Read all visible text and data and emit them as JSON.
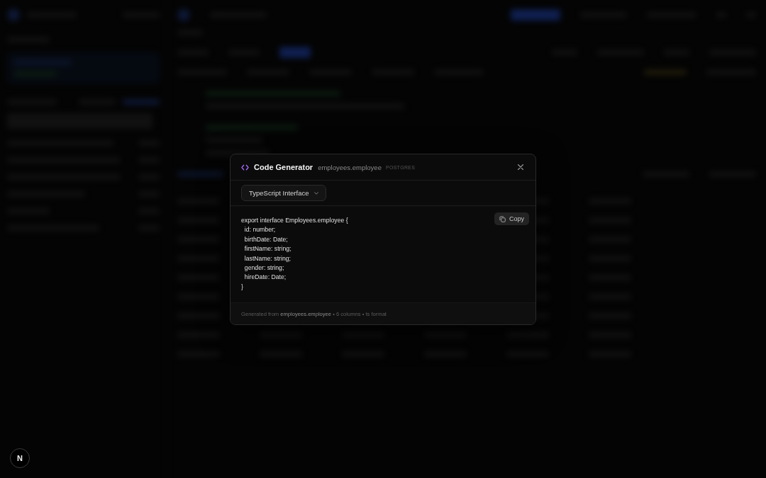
{
  "dialog": {
    "title": "Code Generator",
    "subtitle": "employees.employee",
    "badge": "POSTGRES",
    "format_select": {
      "value": "TypeScript Interface"
    },
    "copy_button": {
      "label": "Copy"
    },
    "code_lines": [
      "export interface Employees.employee {",
      "  id: number;",
      "  birthDate: Date;",
      "  firstName: string;",
      "  lastName: string;",
      "  gender: string;",
      "  hireDate: Date;",
      "}"
    ],
    "footer": "Generated from **employees.employee** • 6 columns • ts format"
  },
  "dev_indicator": {
    "label": "N"
  }
}
